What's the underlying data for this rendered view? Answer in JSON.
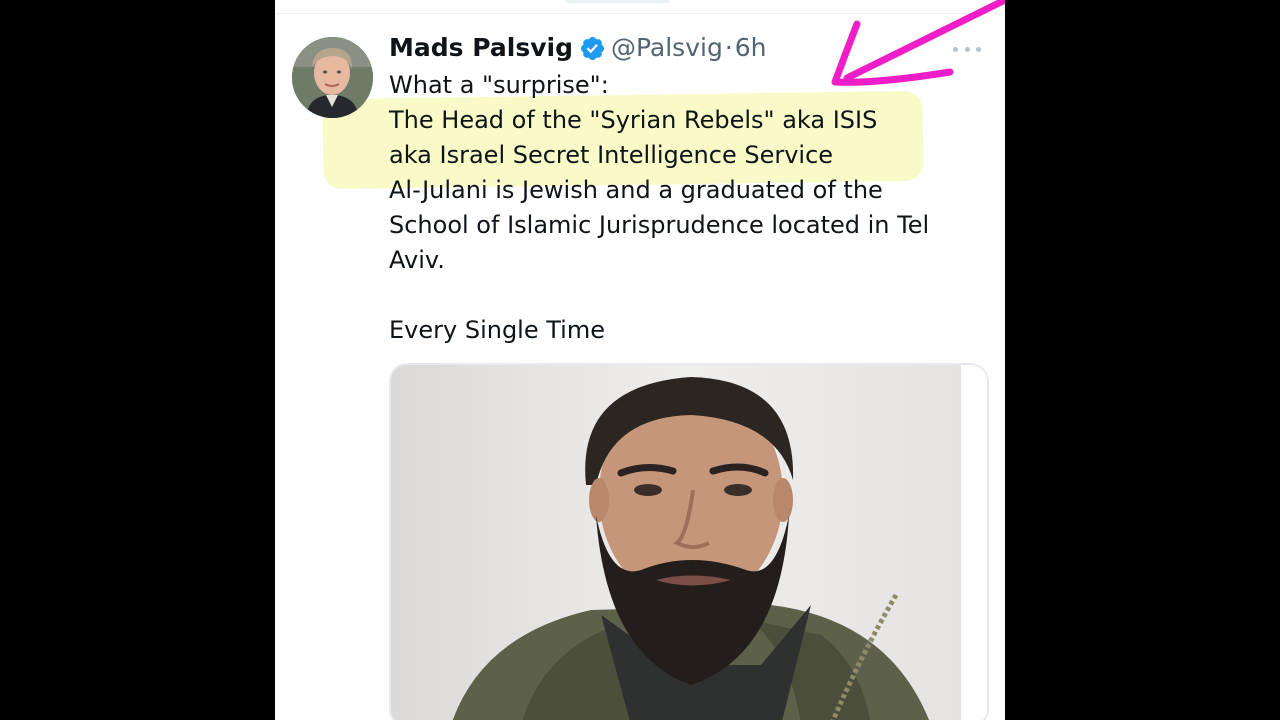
{
  "tweet": {
    "author": {
      "display_name": "Mads Palsvig",
      "verified": true,
      "handle": "@Palsvig",
      "separator": "·",
      "timestamp": "6h"
    },
    "text_lines": [
      "What a \"surprise\":",
      "The Head of the \"Syrian Rebels\" aka ISIS",
      "aka Israel Secret Intelligence Service",
      "Al-Julani is Jewish and a graduated of the",
      "School of Islamic Jurisprudence located in Tel",
      "Aviv."
    ],
    "closing_line": "Every Single Time",
    "more_icon": "more-horizontal-icon",
    "media": {
      "icon": "photo-portrait"
    }
  },
  "annotation": {
    "arrow_color": "#f01ec8",
    "highlight_color": "#f5f7b0"
  },
  "colors": {
    "frame_background": "#000000",
    "card_background": "#ffffff",
    "primary_text": "#0f1419",
    "secondary_text": "#536471",
    "verified_blue": "#1d9bf0"
  }
}
